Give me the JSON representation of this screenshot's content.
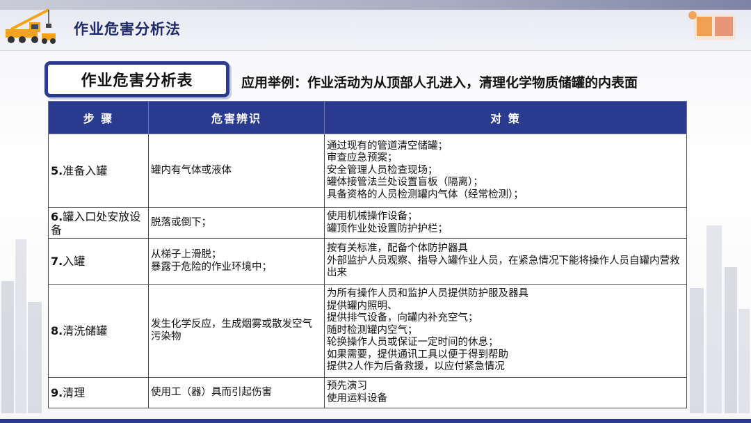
{
  "header": {
    "title": "作业危害分析法"
  },
  "section": {
    "title": "作业危害分析表",
    "example": "应用举例：作业活动为从顶部人孔进入，清理化学物质储罐的内表面"
  },
  "table": {
    "headers": [
      "步 骤",
      "危害辨识",
      "对 策"
    ],
    "rows": [
      {
        "num": "5.",
        "step": "准备入罐",
        "hazards": [
          "罐内有气体或液体"
        ],
        "measures": [
          "通过现有的管道清空储罐；",
          "审查应急预案；",
          "安全管理人员检查现场；",
          "罐体接管法兰处设置盲板（隔离）；",
          "具备资格的人员检测罐内气体（经常检测）；"
        ]
      },
      {
        "num": "6.",
        "step": "罐入口处安放设备",
        "hazards": [
          "脱落或倒下；"
        ],
        "measures": [
          "使用机械操作设备；",
          "罐顶作业处设置防护护栏；"
        ]
      },
      {
        "num": "7.",
        "step": "入罐",
        "hazards": [
          "从梯子上滑脱；",
          "暴露于危险的作业环境中；"
        ],
        "measures": [
          "按有关标准，配备个体防护器具",
          "外部监护人员观察、指导入罐作业人员，在紧急情况下能将操作人员自罐内营救出来"
        ]
      },
      {
        "num": "8.",
        "step": "清洗储罐",
        "hazards": [
          "发生化学反应，生成烟雾或散发空气污染物"
        ],
        "measures": [
          "为所有操作人员和监护人员提供防护服及器具",
          "提供罐内照明、",
          "提供排气设备，向罐内补充空气；",
          "随时检测罐内空气；",
          "轮换操作人员或保证一定时间的休息；",
          "如果需要，提供通讯工具以便于得到帮助",
          "提供2人作为后备救援，以应付紧急情况"
        ]
      },
      {
        "num": "9.",
        "step": "清理",
        "hazards": [
          "使用工（器）具而引起伤害"
        ],
        "measures": [
          "预先演习",
          "使用运料设备"
        ]
      }
    ]
  },
  "colors": {
    "header_blue": "#2a3b8f",
    "title_navy": "#1f2a6b",
    "brand_orange": "#f08a24"
  },
  "icons": {
    "top_left": "crane-truck-icon",
    "top_right": "brand-logo"
  }
}
